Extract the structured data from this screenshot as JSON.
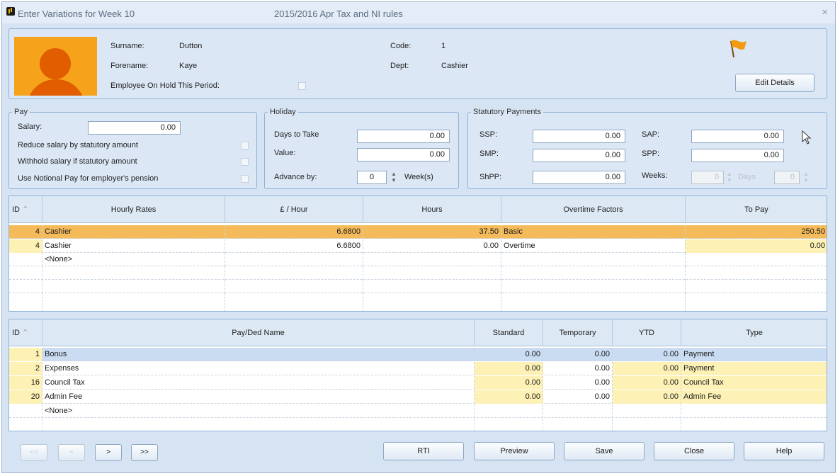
{
  "window": {
    "title": "Enter Variations for Week 10",
    "rules": "2015/2016 Apr Tax and NI rules",
    "close": "×"
  },
  "employee": {
    "surname_label": "Surname:",
    "surname": "Dutton",
    "forename_label": "Forename:",
    "forename": "Kaye",
    "on_hold_label": "Employee On Hold This Period:",
    "code_label": "Code:",
    "code": "1",
    "dept_label": "Dept:",
    "dept": "Cashier",
    "edit_details": "Edit Details"
  },
  "pay": {
    "legend": "Pay",
    "salary_label": "Salary:",
    "salary": "0.00",
    "reduce_label": "Reduce salary by statutory amount",
    "withhold_label": "Withhold salary if statutory amount",
    "notional_label": "Use Notional Pay for employer's pension"
  },
  "holiday": {
    "legend": "Holiday",
    "days_label": "Days to Take",
    "days": "0.00",
    "value_label": "Value:",
    "value": "0.00",
    "advance_label": "Advance by:",
    "advance": "0",
    "weeks_label": "Week(s)"
  },
  "statutory": {
    "legend": "Statutory Payments",
    "ssp_label": "SSP:",
    "ssp": "0.00",
    "smp_label": "SMP:",
    "smp": "0.00",
    "shpp_label": "ShPP:",
    "shpp": "0.00",
    "sap_label": "SAP:",
    "sap": "0.00",
    "spp_label": "SPP:",
    "spp": "0.00",
    "weeks_label": "Weeks:",
    "weeks": "0",
    "days_label": "Days",
    "days": "0"
  },
  "hourly": {
    "headers": [
      "ID",
      "Hourly Rates",
      "£ / Hour",
      "Hours",
      "Overtime Factors",
      "To Pay"
    ],
    "rows": [
      {
        "id": "4",
        "name": "Cashier",
        "rate": "6.6800",
        "hours": "37.50",
        "factor": "Basic",
        "topay": "250.50"
      },
      {
        "id": "4",
        "name": "Cashier",
        "rate": "6.6800",
        "hours": "0.00",
        "factor": "Overtime",
        "topay": "0.00"
      },
      {
        "id": "",
        "name": "<None>",
        "rate": "",
        "hours": "",
        "factor": "",
        "topay": ""
      }
    ]
  },
  "payded": {
    "headers": [
      "ID",
      "Pay/Ded Name",
      "Standard",
      "Temporary",
      "YTD",
      "Type"
    ],
    "rows": [
      {
        "id": "1",
        "name": "Bonus",
        "standard": "0.00",
        "temporary": "0.00",
        "ytd": "0.00",
        "type": "Payment"
      },
      {
        "id": "2",
        "name": "Expenses",
        "standard": "0.00",
        "temporary": "0.00",
        "ytd": "0.00",
        "type": "Payment"
      },
      {
        "id": "16",
        "name": "Council Tax",
        "standard": "0.00",
        "temporary": "0.00",
        "ytd": "0.00",
        "type": "Council Tax"
      },
      {
        "id": "20",
        "name": "Admin Fee",
        "standard": "0.00",
        "temporary": "0.00",
        "ytd": "0.00",
        "type": "Admin Fee"
      },
      {
        "id": "",
        "name": "<None>",
        "standard": "",
        "temporary": "",
        "ytd": "",
        "type": ""
      }
    ]
  },
  "nav": {
    "first": "<<",
    "prev": "<",
    "next": ">",
    "last": ">>"
  },
  "footer": {
    "rti": "RTI",
    "preview": "Preview",
    "save": "Save",
    "close": "Close",
    "help": "Help"
  }
}
